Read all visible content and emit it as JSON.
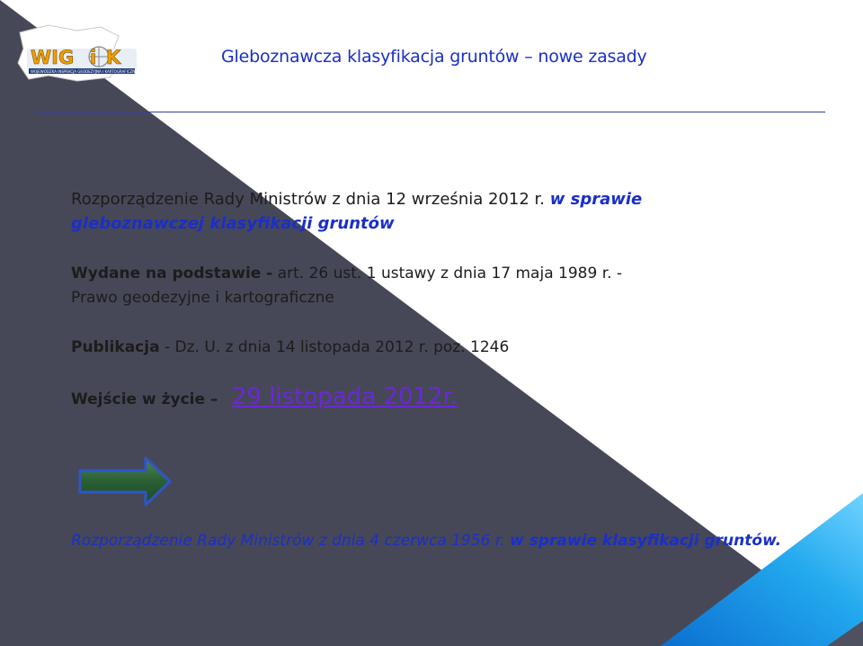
{
  "header": {
    "title": "Gleboznawcza klasyfikacja gruntów – nowe zasady",
    "logo_text": "WIGiK",
    "logo_subtext": "WOJEWÓDZKA INSPEKCJA GEODEZYJNA I KARTOGRAFICZNA"
  },
  "regulation": {
    "text": "Rozporządzenie Rady Ministrów z dnia 12 września 2012 r.",
    "emphasis_line1": "w sprawie",
    "emphasis_line2": "gleboznawczej klasyfikacji gruntów"
  },
  "issued": {
    "label": "Wydane na podstawie -",
    "line1": "art. 26 ust. 1 ustawy z dnia 17 maja 1989 r. -",
    "line2": "Prawo geodezyjne i kartograficzne"
  },
  "publication": {
    "label": "Publikacja",
    "text": "- Dz. U. z dnia 14 listopada 2012 r. poz. 1246"
  },
  "effective": {
    "label": "Wejście w życie –",
    "date": "29 listopada 2012r."
  },
  "previous": {
    "text": "Rozporządzenie Rady Ministrów z dnia 4 czerwca 1956 r.",
    "emphasis": "w sprawie klasyfikacji gruntów."
  },
  "colors": {
    "accent_blue": "#1a2fc8",
    "dark_triangle": "#474857",
    "link_purple": "#6a28d6",
    "arrow_green": "#2f6a3a"
  }
}
